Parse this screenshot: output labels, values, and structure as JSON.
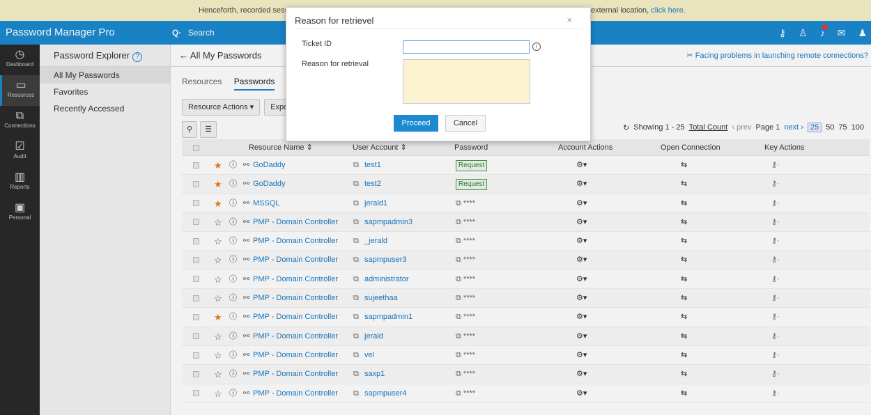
{
  "notice": {
    "left_text": "Henceforth, recorded session",
    "right_text": "external location,",
    "link_label": "click here."
  },
  "brand": {
    "name": "Password Manager Pro"
  },
  "search": {
    "label": "Search"
  },
  "sidenav": [
    {
      "label": "Dashboard",
      "icon": "dashboard-icon",
      "glyph": "◷"
    },
    {
      "label": "Resources",
      "icon": "monitor-icon",
      "glyph": "▭"
    },
    {
      "label": "Connections",
      "icon": "connections-icon",
      "glyph": "⧉"
    },
    {
      "label": "Audit",
      "icon": "audit-icon",
      "glyph": "☑"
    },
    {
      "label": "Reports",
      "icon": "reports-icon",
      "glyph": "▥"
    },
    {
      "label": "Personal",
      "icon": "personal-icon",
      "glyph": "▣"
    }
  ],
  "explorer": {
    "title": "Password Explorer",
    "items": [
      "All My Passwords",
      "Favorites",
      "Recently Accessed"
    ]
  },
  "main": {
    "title": "All My Passwords",
    "help_link": "Facing problems in launching remote connections?",
    "tabs": [
      "Resources",
      "Passwords"
    ],
    "resource_actions": "Resource Actions ▾",
    "export": "Expor"
  },
  "paging": {
    "showing": "Showing 1 - 25",
    "total": "Total Count",
    "prev": "prev",
    "page": "Page 1",
    "next": "next",
    "sizes": [
      "25",
      "50",
      "75",
      "100"
    ]
  },
  "table": {
    "headers": [
      "Resource Name",
      "User Account",
      "Password",
      "Account Actions",
      "Open Connection",
      "Key Actions"
    ],
    "rows": [
      {
        "fav": true,
        "resource": "GoDaddy",
        "user": "test1",
        "password": "Request",
        "request": true
      },
      {
        "fav": true,
        "resource": "GoDaddy",
        "user": "test2",
        "password": "Request",
        "request": true
      },
      {
        "fav": true,
        "resource": "MSSQL",
        "user": "jerald1",
        "password": "****",
        "request": false
      },
      {
        "fav": false,
        "resource": "PMP - Domain Controller",
        "user": "sapmpadmin3",
        "password": "****",
        "request": false
      },
      {
        "fav": false,
        "resource": "PMP - Domain Controller",
        "user": "_jerald",
        "password": "****",
        "request": false
      },
      {
        "fav": false,
        "resource": "PMP - Domain Controller",
        "user": "sapmpuser3",
        "password": "****",
        "request": false
      },
      {
        "fav": false,
        "resource": "PMP - Domain Controller",
        "user": "administrator",
        "password": "****",
        "request": false
      },
      {
        "fav": false,
        "resource": "PMP - Domain Controller",
        "user": "sujeethaa",
        "password": "****",
        "request": false
      },
      {
        "fav": true,
        "resource": "PMP - Domain Controller",
        "user": "sapmpadmin1",
        "password": "****",
        "request": false
      },
      {
        "fav": false,
        "resource": "PMP - Domain Controller",
        "user": "jerald",
        "password": "****",
        "request": false
      },
      {
        "fav": false,
        "resource": "PMP - Domain Controller",
        "user": "vel",
        "password": "****",
        "request": false
      },
      {
        "fav": false,
        "resource": "PMP - Domain Controller",
        "user": "saxp1",
        "password": "****",
        "request": false
      },
      {
        "fav": false,
        "resource": "PMP - Domain Controller",
        "user": "sapmpuser4",
        "password": "****",
        "request": false
      }
    ]
  },
  "modal": {
    "title": "Reason for retrievel",
    "ticket_label": "Ticket ID",
    "ticket_value": "",
    "reason_label": "Reason for retrieval",
    "reason_value": "",
    "proceed": "Proceed",
    "cancel": "Cancel"
  },
  "colors": {
    "brand_blue": "#1b8ad0",
    "favorite_orange": "#e67e22",
    "request_green": "#2e7d32",
    "textarea_bg": "#fbf2cf"
  }
}
